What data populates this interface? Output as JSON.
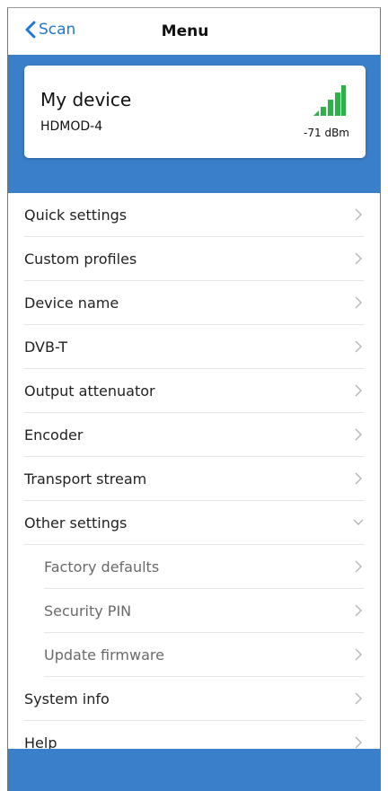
{
  "nav": {
    "back_label": "Scan",
    "title": "Menu"
  },
  "device": {
    "name": "My device",
    "model": "HDMOD-4",
    "rssi": "-71 dBm",
    "signal_icon": "signal-bars-icon"
  },
  "colors": {
    "accent": "#3A7FC9",
    "link": "#1E78D6",
    "signal": "#2DB24A"
  },
  "menu": [
    {
      "label": "Quick settings",
      "chevron": "chevron-right-icon"
    },
    {
      "label": "Custom profiles",
      "chevron": "chevron-right-icon"
    },
    {
      "label": "Device name",
      "chevron": "chevron-right-icon"
    },
    {
      "label": "DVB-T",
      "chevron": "chevron-right-icon"
    },
    {
      "label": "Output attenuator",
      "chevron": "chevron-right-icon"
    },
    {
      "label": "Encoder",
      "chevron": "chevron-right-icon"
    },
    {
      "label": "Transport stream",
      "chevron": "chevron-right-icon"
    },
    {
      "label": "Other settings",
      "chevron": "chevron-down-icon",
      "expanded": true
    },
    {
      "label": "Factory defaults",
      "chevron": "chevron-right-icon",
      "sub": true
    },
    {
      "label": "Security PIN",
      "chevron": "chevron-right-icon",
      "sub": true
    },
    {
      "label": "Update firmware",
      "chevron": "chevron-right-icon",
      "sub": true
    },
    {
      "label": "System info",
      "chevron": "chevron-right-icon"
    },
    {
      "label": "Help",
      "chevron": "chevron-right-icon"
    }
  ]
}
